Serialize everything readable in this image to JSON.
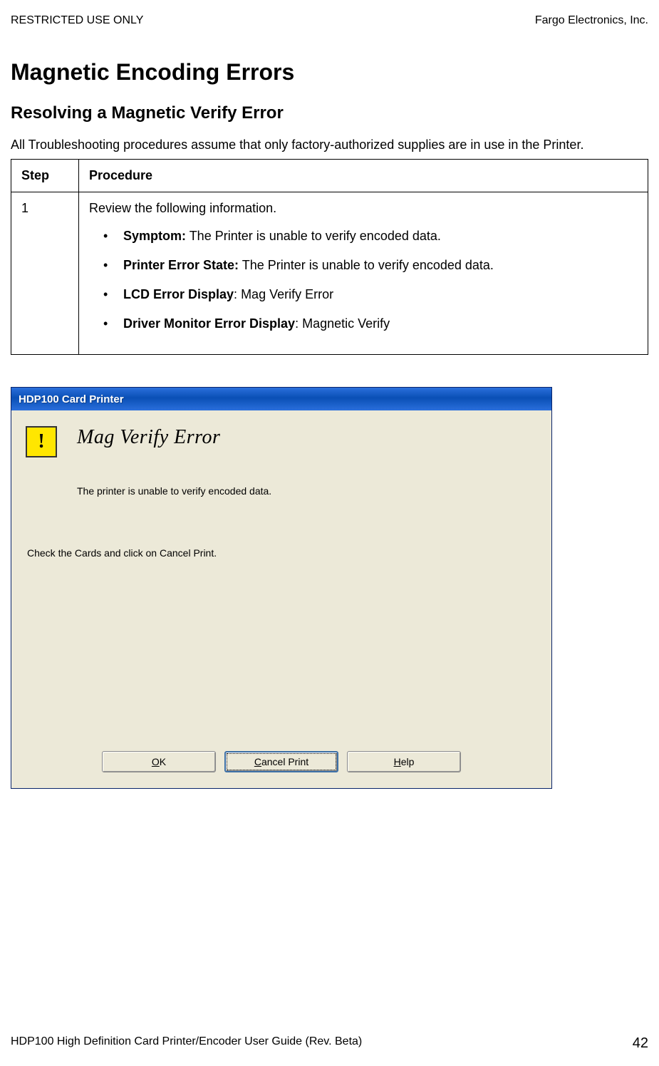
{
  "header": {
    "left": "RESTRICTED USE ONLY",
    "right": "Fargo Electronics, Inc."
  },
  "title": "Magnetic Encoding Errors",
  "subtitle": "Resolving a Magnetic Verify Error",
  "intro": "All Troubleshooting procedures assume that only factory-authorized supplies are in use in the Printer.",
  "table": {
    "headers": {
      "step": "Step",
      "procedure": "Procedure"
    },
    "row": {
      "step": "1",
      "lead": "Review the following information.",
      "items": [
        {
          "label": "Symptom:",
          "text": "  The Printer is unable to verify encoded data."
        },
        {
          "label": "Printer Error State:",
          "text": "  The Printer is unable to verify encoded data."
        },
        {
          "label": "LCD Error Display",
          "colon": ":",
          "text": "  Mag Verify Error"
        },
        {
          "label": "Driver Monitor Error Display",
          "colon": ":",
          "text": "  Magnetic Verify"
        }
      ]
    }
  },
  "dialog": {
    "titlebar": "HDP100 Card Printer",
    "heading": "Mag Verify Error",
    "message1": "The printer is unable to verify encoded data.",
    "message2": "Check the Cards and click on Cancel Print.",
    "buttons": {
      "ok": {
        "u": "O",
        "rest": "K"
      },
      "cancel": {
        "u": "C",
        "rest": "ancel Print"
      },
      "help": {
        "u": "H",
        "rest": "elp"
      }
    }
  },
  "footer": {
    "left": "HDP100 High Definition Card Printer/Encoder User Guide (Rev. Beta)",
    "page": "42"
  }
}
